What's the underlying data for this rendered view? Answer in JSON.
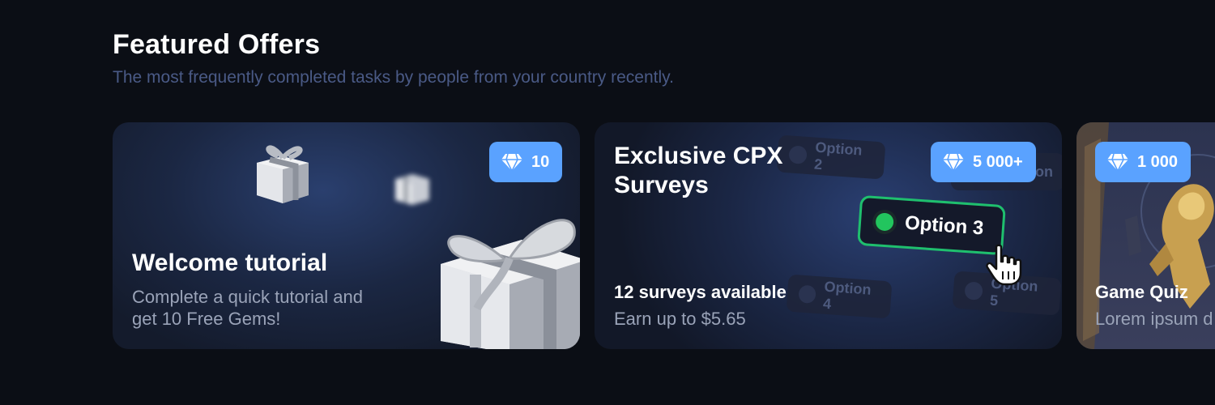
{
  "header": {
    "title": "Featured Offers",
    "subtitle": "The most frequently completed tasks by people from your country recently."
  },
  "colors": {
    "background": "#0b0e15",
    "badge": "#5aa2ff",
    "subtitle": "#4a5a86",
    "selected_option_border": "#1fbf6e"
  },
  "cards": {
    "tutorial": {
      "badge": "10",
      "badge_icon": "gem-icon",
      "title": "Welcome tutorial",
      "description": "Complete a quick tutorial and get 10 Free Gems!"
    },
    "surveys": {
      "badge": "5 000+",
      "badge_icon": "gem-icon",
      "title": "Exclusive CPX Surveys",
      "count": "12 surveys available",
      "earn": "Earn up to $5.65",
      "options": [
        "Option 2",
        "Option 3",
        "Option 4",
        "Option 5"
      ],
      "partial_option": "on"
    },
    "quiz": {
      "badge": "1 000",
      "badge_icon": "gem-icon",
      "title": "Game Quiz",
      "description": "Lorem ipsum d"
    }
  }
}
